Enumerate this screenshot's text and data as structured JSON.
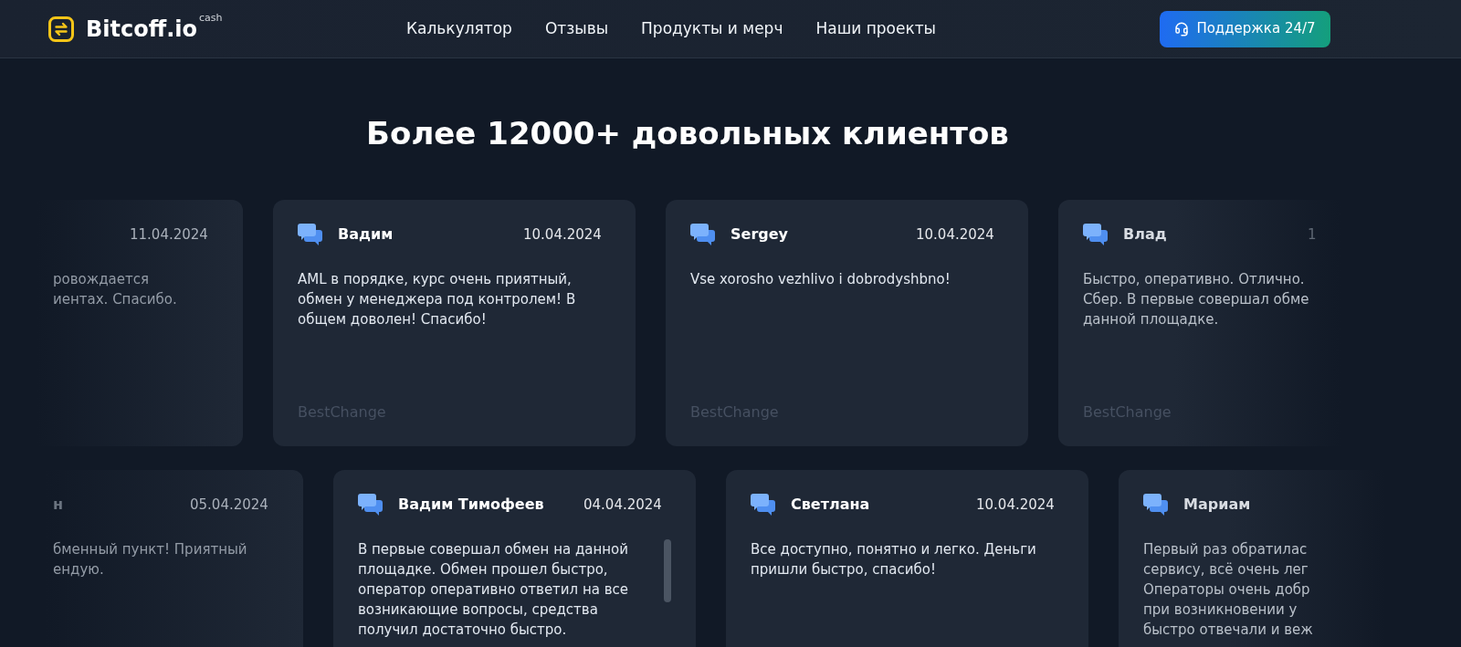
{
  "header": {
    "logo": {
      "name": "Bitcoff.io",
      "tag": "cash"
    },
    "nav": [
      {
        "label": "Калькулятор"
      },
      {
        "label": "Отзывы"
      },
      {
        "label": "Продукты и мерч"
      },
      {
        "label": "Наши проекты"
      }
    ],
    "support_button": {
      "label": "Поддержка 24/7"
    }
  },
  "title": "Более 12000+ довольных клиентов",
  "rows": [
    {
      "reviews": [
        {
          "kind": "left",
          "date": "11.04.2024",
          "text": "ровождается\nиентах. Спасибо.",
          "scrollable": false
        },
        {
          "kind": "whole",
          "author": "Вадим",
          "date": "10.04.2024",
          "text": "AML в порядке, курс очень приятный, обмен у менеджера под контролем! В общем доволен! Спасибо!",
          "source": "BestChange",
          "scrollable": false
        },
        {
          "kind": "whole",
          "author": "Sergey",
          "date": "10.04.2024",
          "text": "Vse xorosho vezhlivo i dobrodyshbno!",
          "source": "BestChange",
          "scrollable": false
        },
        {
          "kind": "right",
          "author": "Влад",
          "date": "1",
          "text": "Быстро, оперативно. Отлично.\nСбер. В первые совершал обме\nданной площадке.",
          "source": "BestChange",
          "scrollable": false
        }
      ]
    },
    {
      "reviews": [
        {
          "kind": "left",
          "author": "н",
          "date": "05.04.2024",
          "text": "бменный пункт! Приятный\nендую.",
          "scrollable": false
        },
        {
          "kind": "whole",
          "author": "Вадим Тимофеев",
          "date": "04.04.2024",
          "text": "В первые совершал обмен на данной площадке. Обмен прошел быстро, оператор оперативно ответил на все возникающие вопросы, средства получил достаточно быстро.",
          "scrollable": true
        },
        {
          "kind": "whole",
          "author": "Светлана",
          "date": "10.04.2024",
          "text": "Все доступно, понятно и легко. Деньги пришли быстро, спасибо!",
          "scrollable": false
        },
        {
          "kind": "right",
          "author": "Мариам",
          "text": "Первый раз обратилас\nсервису, всё очень лег\nОператоры очень добр\nпри возникновении у\nбыстро отвечали и веж",
          "scrollable": false
        }
      ]
    }
  ]
}
